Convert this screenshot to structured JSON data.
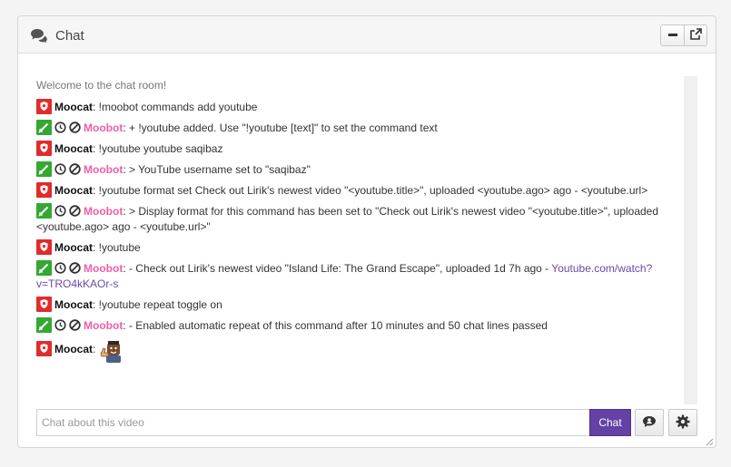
{
  "panel": {
    "title": "Chat",
    "header_icons": [
      "chat-bubbles-icon"
    ],
    "buttons": [
      "minimize-icon",
      "popout-icon"
    ]
  },
  "welcome": "Welcome to the chat room!",
  "messages": [
    {
      "user": "Moocat",
      "role": "broadcaster",
      "text": ": !moobot commands add youtube"
    },
    {
      "user": "Moobot",
      "role": "moderator",
      "text": ": + !youtube added. Use \"!youtube [text]\" to set the command text"
    },
    {
      "user": "Moocat",
      "role": "broadcaster",
      "text": ": !youtube youtube saqibaz"
    },
    {
      "user": "Moobot",
      "role": "moderator",
      "text": ": > YouTube username set to \"saqibaz\""
    },
    {
      "user": "Moocat",
      "role": "broadcaster",
      "text": ": !youtube format set Check out Lirik's newest video \"<youtube.title>\", uploaded <youtube.ago> ago - <youtube.url>"
    },
    {
      "user": "Moobot",
      "role": "moderator",
      "text": ": > Display format for this command has been set to \"Check out Lirik's newest video \"<youtube.title>\", uploaded <youtube.ago> ago - <youtube.url>\""
    },
    {
      "user": "Moocat",
      "role": "broadcaster",
      "text": ": !youtube"
    },
    {
      "user": "Moobot",
      "role": "moderator",
      "text": ": - Check out Lirik's newest video \"Island Life: The Grand Escape\", uploaded 1d 7h ago - ",
      "link": "Youtube.com/watch?v=TRO4kKAOr-s"
    },
    {
      "user": "Moocat",
      "role": "broadcaster",
      "text": ": !youtube repeat toggle on"
    },
    {
      "user": "Moobot",
      "role": "moderator",
      "text": ": - Enabled automatic repeat of this command after 10 minutes and 50 chat lines passed"
    },
    {
      "user": "Moocat",
      "role": "broadcaster",
      "text": ":",
      "emote": "thumbs-up-emote"
    }
  ],
  "input": {
    "placeholder": "Chat about this video",
    "value": ""
  },
  "chat_button": "Chat",
  "colors": {
    "accent": "#6441a5",
    "broadcaster_badge": "#e02c2c",
    "moderator_badge": "#34a833",
    "bot_name": "#ee5ea7",
    "link": "#6c4aa7"
  }
}
